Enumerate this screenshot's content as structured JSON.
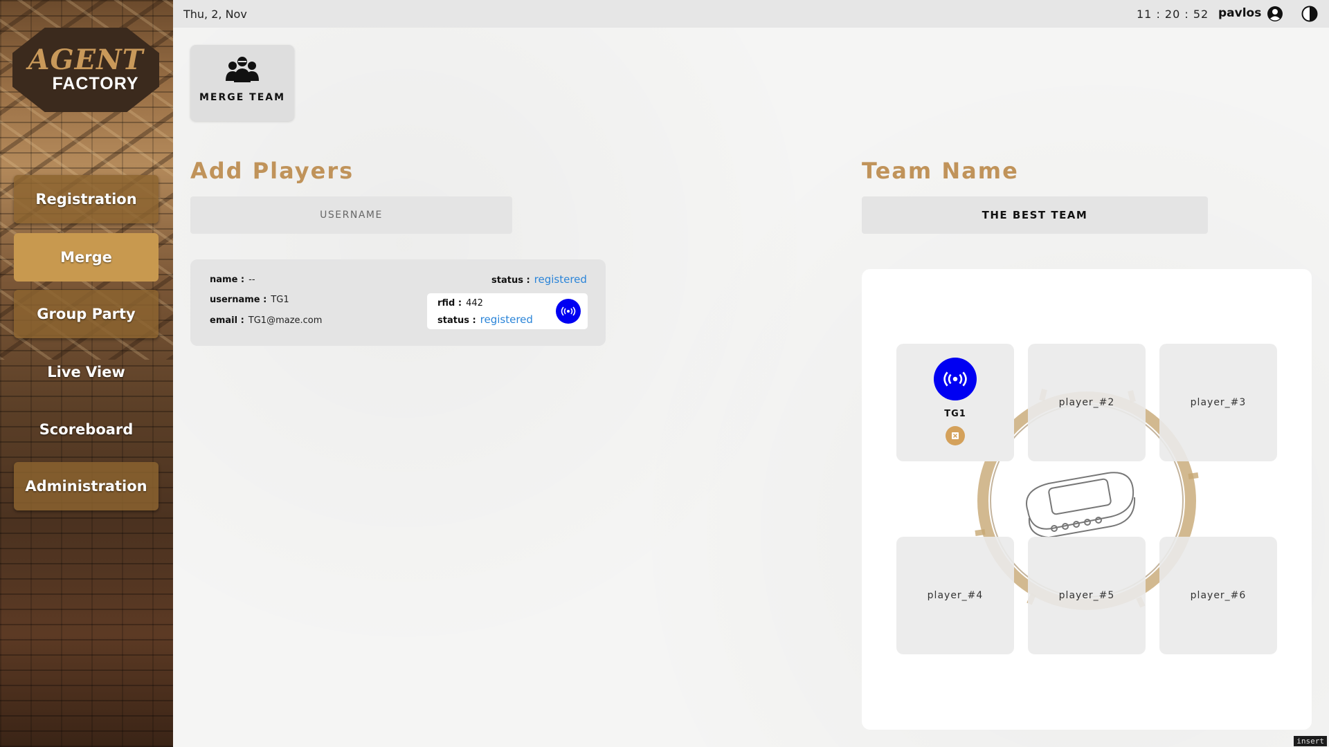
{
  "sidebar": {
    "logo": {
      "line1": "AGENT",
      "line2": "FACTORY"
    },
    "items": [
      {
        "label": "Registration"
      },
      {
        "label": "Merge"
      },
      {
        "label": "Group Party"
      },
      {
        "label": "Live View"
      },
      {
        "label": "Scoreboard"
      },
      {
        "label": "Administration"
      }
    ],
    "active_item": "Merge"
  },
  "topbar": {
    "date": "Thu, 2, Nov",
    "clock": "11 : 20 : 52",
    "user": "pavlos",
    "user_icon": "user-circle-icon",
    "theme_icon": "contrast-icon"
  },
  "merge_team": {
    "label": "MERGE TEAM",
    "icon": "group-icon"
  },
  "add_players": {
    "title": "Add Players",
    "username_placeholder": "USERNAME",
    "player": {
      "name_label": "name :",
      "name_value": "--",
      "username_label": "username :",
      "username_value": "TG1",
      "email_label": "email :",
      "email_value": "TG1@maze.com",
      "status_label": "status :",
      "status_value": "registered",
      "rfid_label": "rfid :",
      "rfid_value": "442",
      "rfid_status_label": "status :",
      "rfid_status_value": "registered",
      "rfid_icon": "rfid-signal-icon"
    }
  },
  "team": {
    "title": "Team Name",
    "name_value": "THE BEST TEAM",
    "slots": [
      {
        "label": "TG1",
        "filled": true
      },
      {
        "label": "player_#2",
        "filled": false
      },
      {
        "label": "player_#3",
        "filled": false
      },
      {
        "label": "player_#4",
        "filled": false
      },
      {
        "label": "player_#5",
        "filled": false
      },
      {
        "label": "player_#6",
        "filled": false
      }
    ]
  },
  "colors": {
    "accent_gold": "#c0935a",
    "active_nav": "#c8994f",
    "rfid_blue": "#0000f2",
    "status_blue": "#2a84d8"
  },
  "insert_badge": "insert"
}
